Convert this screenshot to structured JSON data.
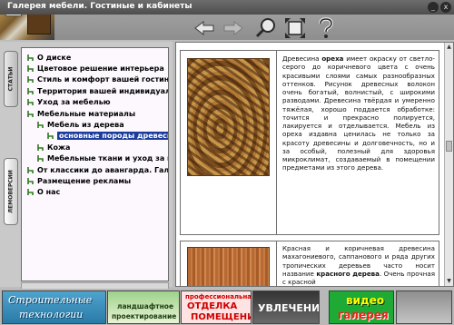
{
  "window": {
    "title": "Галерея мебели. Гостиные и кабинеты",
    "btn_minimize": "_",
    "btn_close": "x"
  },
  "toolbar": {
    "back": "arrow-left-icon",
    "forward": "arrow-right-icon",
    "search": "magnifier-icon",
    "fullscreen": "expand-icon",
    "help": "question-icon"
  },
  "side_tabs": {
    "articles": "СТАТЬИ",
    "lemoversii": "ЛЕМОВЕРСИИ"
  },
  "tree": [
    {
      "label": "О диске",
      "level": 0
    },
    {
      "label": "Цветовое решение интерьера",
      "level": 0
    },
    {
      "label": "Стиль и комфорт вашей гостиной",
      "level": 0
    },
    {
      "label": "Территория вашей индивидуаль",
      "level": 0
    },
    {
      "label": "Уход за мебелью",
      "level": 0
    },
    {
      "label": "Мебельные материалы",
      "level": 0
    },
    {
      "label": "Мебель из дерева",
      "level": 1
    },
    {
      "label": "основные породы древесин",
      "level": 2,
      "selected": true
    },
    {
      "label": "Кожа",
      "level": 1
    },
    {
      "label": "Мебельные ткани и уход за н",
      "level": 1
    },
    {
      "label": "От классики до авангарда. Гале",
      "level": 0
    },
    {
      "label": "Размещение рекламы",
      "level": 0
    },
    {
      "label": "О нас",
      "level": 0
    }
  ],
  "content": {
    "para1_pre": "Древесина ",
    "para1_bold": "ореха",
    "para1_post": " имеет окраску от светло-серого до коричневого цвета с очень красивыми слоями самых разнообразных оттенков. Рисунок древесных волокон очень богатый, волнистый, с широкими разводами. Древесина твёрдая и умеренно тяжёлая, хорошо поддается обработке: точится и прекрасно полируется, лакируется и отделывается. Мебель из ореха издавна ценилась не только за красоту древесины и долговечность, но и за особый, полезный для здоровья микроклимат, создаваемый в помещении предметами из этого дерева.",
    "para2_pre": "Красная и коричневая древесина махагониевого, саппанового и ряда других тропических деревьев часто носит название ",
    "para2_bold": "красного дерева",
    "para2_post": ". Очень прочная с красной"
  },
  "banners": {
    "b1_line1": "Строительные",
    "b1_line2": "технологии",
    "b2_line1": "ландшафтное",
    "b2_line2": "проектирование",
    "b3_line1": "профессиональная",
    "b3_line2": "ОТДЕЛКА",
    "b3_line3": "ПОМЕЩЕНИЙ",
    "b4": "УВЛЕЧЕНИЯ",
    "b6_line1": "видео",
    "b6_line2": "галерея"
  },
  "colors": {
    "selection": "#1c3c9c",
    "tree_bg": "#fcf8fe",
    "tree_icon": "#2f7a1f"
  }
}
